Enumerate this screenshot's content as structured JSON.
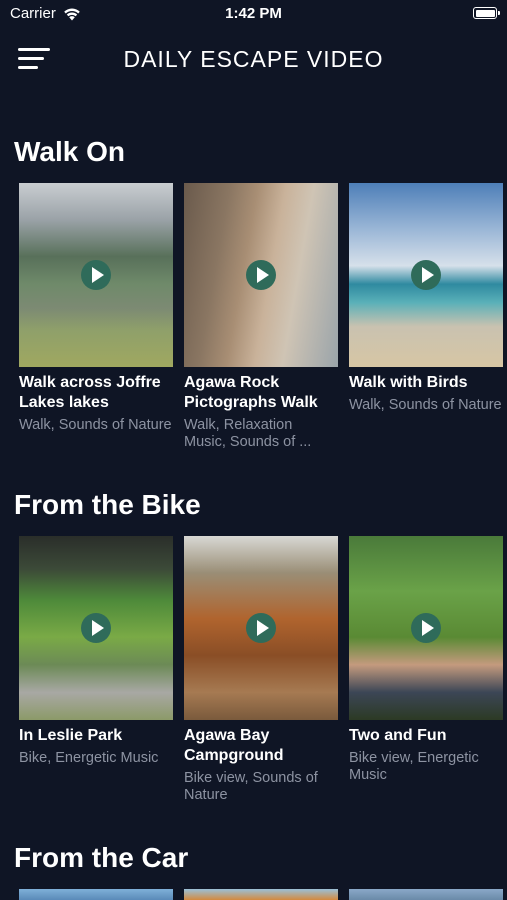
{
  "status_bar": {
    "carrier": "Carrier",
    "time": "1:42 PM"
  },
  "header": {
    "title": "DAILY ESCAPE VIDEO",
    "menu_icon": "hamburger-menu-icon"
  },
  "sections": [
    {
      "title": "Walk On",
      "items": [
        {
          "title": "Walk across Joffre Lakes lakes",
          "tags": "Walk, Sounds of Nature"
        },
        {
          "title": "Agawa Rock Pictographs Walk",
          "tags": "Walk, Relaxation Music, Sounds of ..."
        },
        {
          "title": "Walk with Birds",
          "tags": "Walk, Sounds of Nature"
        }
      ]
    },
    {
      "title": "From the Bike",
      "items": [
        {
          "title": "In Leslie Park",
          "tags": "Bike, Energetic Music"
        },
        {
          "title": "Agawa Bay Campground",
          "tags": "Bike view, Sounds of Nature"
        },
        {
          "title": "Two and Fun",
          "tags": "Bike view, Energetic Music"
        }
      ]
    },
    {
      "title": "From the Car"
    }
  ],
  "colors": {
    "background": "#0f1525",
    "play_button": "#2f6b5a",
    "tag_text": "#8d93a2"
  }
}
